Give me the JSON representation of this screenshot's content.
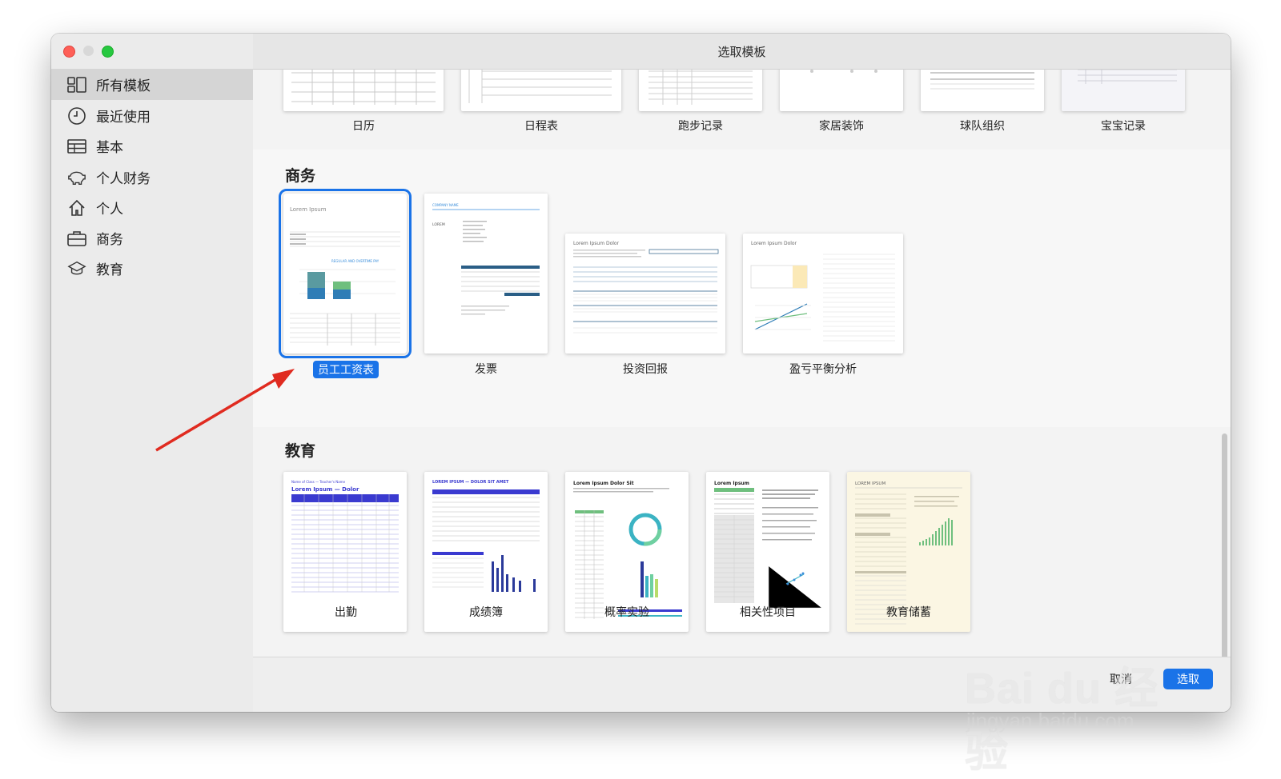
{
  "window": {
    "title": "选取模板"
  },
  "sidebar": {
    "items": [
      {
        "label": "所有模板",
        "icon": "grid-icon",
        "active": true
      },
      {
        "label": "最近使用",
        "icon": "clock-icon"
      },
      {
        "label": "基本",
        "icon": "table-icon"
      },
      {
        "label": "个人财务",
        "icon": "piggy-bank-icon"
      },
      {
        "label": "个人",
        "icon": "house-icon"
      },
      {
        "label": "商务",
        "icon": "briefcase-icon"
      },
      {
        "label": "教育",
        "icon": "graduation-cap-icon"
      }
    ]
  },
  "top_row": {
    "templates": [
      "日历",
      "日程表",
      "跑步记录",
      "家居装饰",
      "球队组织",
      "宝宝记录"
    ]
  },
  "business": {
    "heading": "商务",
    "templates": [
      "员工工资表",
      "发票",
      "投资回报",
      "盈亏平衡分析"
    ],
    "selected": "员工工资表"
  },
  "education": {
    "heading": "教育",
    "templates": [
      "出勤",
      "成绩簿",
      "概率实验",
      "相关性项目",
      "教育储蓄"
    ]
  },
  "footer": {
    "cancel_label": "取消",
    "choose_label": "选取"
  },
  "watermark": {
    "brand": "Bai du 经验",
    "url": "jingyan.baidu.com"
  },
  "thumb_text": {
    "payroll_title": "Lorem Ipsum",
    "invoice_company": "COMPANY NAME",
    "invoice_lorem": "LOREM",
    "roi_title": "Lorem Ipsum Dolor",
    "breakeven_title": "Lorem Ipsum Dolor",
    "attendance_sub": "Name of Class — Teacher's Name",
    "attendance_title": "Lorem Ipsum — Dolor",
    "gradebook_title": "LOREM IPSUM — DOLOR SIT AMET",
    "probability_title": "Lorem Ipsum Dolor Sit",
    "correlation_title": "Lorem Ipsum",
    "savings_title": "LOREM IPSUM"
  },
  "colors": {
    "accent": "#1a73e8",
    "arrow": "#e02b20"
  }
}
